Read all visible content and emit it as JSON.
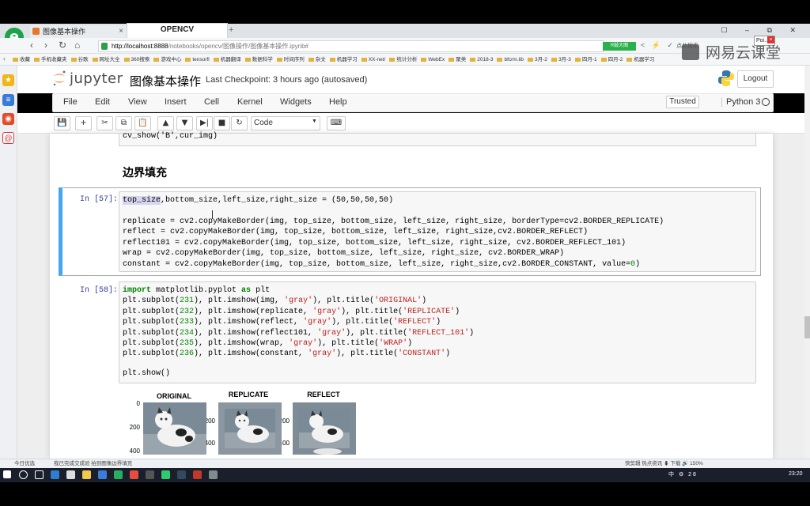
{
  "browser": {
    "tabs": [
      {
        "label": "图像基本操作",
        "close": "×"
      },
      {
        "label": "OPENCV"
      }
    ],
    "new_tab": "+",
    "window_controls": "☐ – ⧉ ✕",
    "popup_label": "Poi..",
    "popup_close": "×",
    "url_host": "http://localhost:8888",
    "url_path": "/notebooks/opencv/图像操作/图像基本操作.ipynb#",
    "ext_badge": "R鼓大图",
    "search_hint": "点此搜索",
    "bookmarks": [
      "收藏",
      "手机收藏夹",
      "谷歌",
      "网址大全",
      "360搜索",
      "游戏中心",
      "tensorfl",
      "机器翻译",
      "数据科学",
      "时间序列",
      "杂文",
      "机器学习",
      "XX-net/",
      "统计分析",
      "WebEx",
      "聚类",
      "2018-3",
      "bfcrm.lib",
      "3月-2",
      "3月-3",
      "四月-1",
      "四月-2",
      "机器学习"
    ],
    "watermark": "网易云课堂"
  },
  "jupyter": {
    "wordmark": "jupyter",
    "title": "图像基本操作",
    "checkpoint": "Last Checkpoint: 3 hours ago (autosaved)",
    "logout": "Logout",
    "menu": [
      "File",
      "Edit",
      "View",
      "Insert",
      "Cell",
      "Kernel",
      "Widgets",
      "Help"
    ],
    "trusted": "Trusted",
    "kernel": "Python 3",
    "toolbar": {
      "save": "💾",
      "add": "+",
      "cut": "✂",
      "copy": "⧉",
      "paste": "📋",
      "up": "▲",
      "down": "▼",
      "run": "▶|",
      "stop": "■",
      "restart": "↻",
      "cell_type": "Code",
      "keyboard": "⌨"
    }
  },
  "notebook": {
    "prev_code": "cv_show('B',cur_img)",
    "section_heading": "边界填充",
    "cell57": {
      "prompt": "In [57]:",
      "line1_sel": "top_size",
      "line1_rest": ",bottom_size,left_size,right_size = (50,50,50,50)",
      "lines": [
        "replicate = cv2.copyMakeBorder(img, top_size, bottom_size, left_size, right_size, borderType=cv2.BORDER_REPLICATE)",
        "reflect = cv2.copyMakeBorder(img, top_size, bottom_size, left_size, right_size,cv2.BORDER_REFLECT)",
        "reflect101 = cv2.copyMakeBorder(img, top_size, bottom_size, left_size, right_size, cv2.BORDER_REFLECT_101)",
        "wrap = cv2.copyMakeBorder(img, top_size, bottom_size, left_size, right_size, cv2.BORDER_WRAP)",
        "constant = cv2.copyMakeBorder(img, top_size, bottom_size, left_size, right_size,cv2.BORDER_CONSTANT, value=0)"
      ]
    },
    "cell58": {
      "prompt": "In [58]:",
      "import_kw": "import",
      "import_mod": " matplotlib.pyplot ",
      "as_kw": "as",
      "import_alias": " plt",
      "lines": [
        "plt.subplot(231), plt.imshow(img, 'gray'), plt.title('ORIGINAL')",
        "plt.subplot(232), plt.imshow(replicate, 'gray'), plt.title('REPLICATE')",
        "plt.subplot(233), plt.imshow(reflect, 'gray'), plt.title('REFLECT')",
        "plt.subplot(234), plt.imshow(reflect101, 'gray'), plt.title('REFLECT_101')",
        "plt.subplot(235), plt.imshow(wrap, 'gray'), plt.title('WRAP')",
        "plt.subplot(236), plt.imshow(constant, 'gray'), plt.title('CONSTANT')"
      ],
      "show_line": "plt.show()"
    },
    "outputs": [
      {
        "title": "ORIGINAL",
        "ticks": [
          "0",
          "200",
          "400"
        ]
      },
      {
        "title": "REPLICATE",
        "ticks": [
          "0",
          "200",
          "400"
        ]
      },
      {
        "title": "REFLECT",
        "ticks": [
          "0",
          "200",
          "400"
        ]
      }
    ]
  },
  "statusbar": {
    "left1": "今日优选",
    "left2": "我已完成交成验 拍到图像边界填充",
    "right": "快剪辑  热点资讯  ⬇ 下载  🔊  150%"
  },
  "taskbar": {
    "time": "23:20",
    "tray": "中 ⚙ 28"
  },
  "colors": {
    "accent_selected": "#42a5f5",
    "prompt": "#303f9f",
    "keyword": "#008000",
    "string": "#ba2121"
  }
}
